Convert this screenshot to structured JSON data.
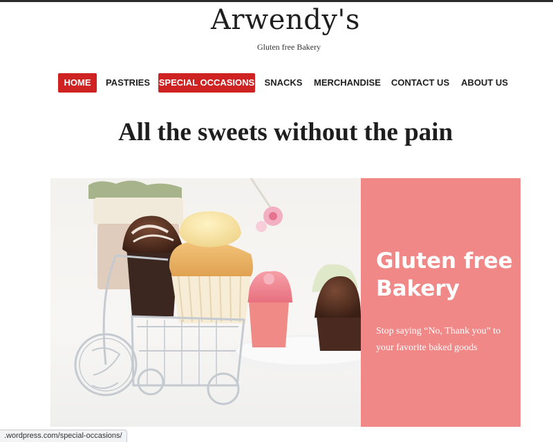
{
  "site": {
    "title": "Arwendy's",
    "tagline": "Gluten free Bakery"
  },
  "nav": {
    "items": [
      {
        "label": "HOME",
        "active": true
      },
      {
        "label": "PASTRIES",
        "active": false
      },
      {
        "label": "SPECIAL OCCASIONS",
        "active": true
      },
      {
        "label": "SNACKS",
        "active": false
      },
      {
        "label": "MERCHANDISE",
        "active": false
      },
      {
        "label": "CONTACT US",
        "active": false
      },
      {
        "label": "ABOUT US",
        "active": false
      }
    ]
  },
  "hero": {
    "heading": "All the sweets without the pain"
  },
  "promo": {
    "title": "Gluten free Bakery",
    "text": "Stop saying “No, Thank you” to your favorite baked goods"
  },
  "status_bar": {
    "url": ".wordpress.com/special-occasions/"
  },
  "colors": {
    "accent": "#cf2222",
    "promo_bg": "#f08888",
    "text": "#1e1e1e"
  }
}
